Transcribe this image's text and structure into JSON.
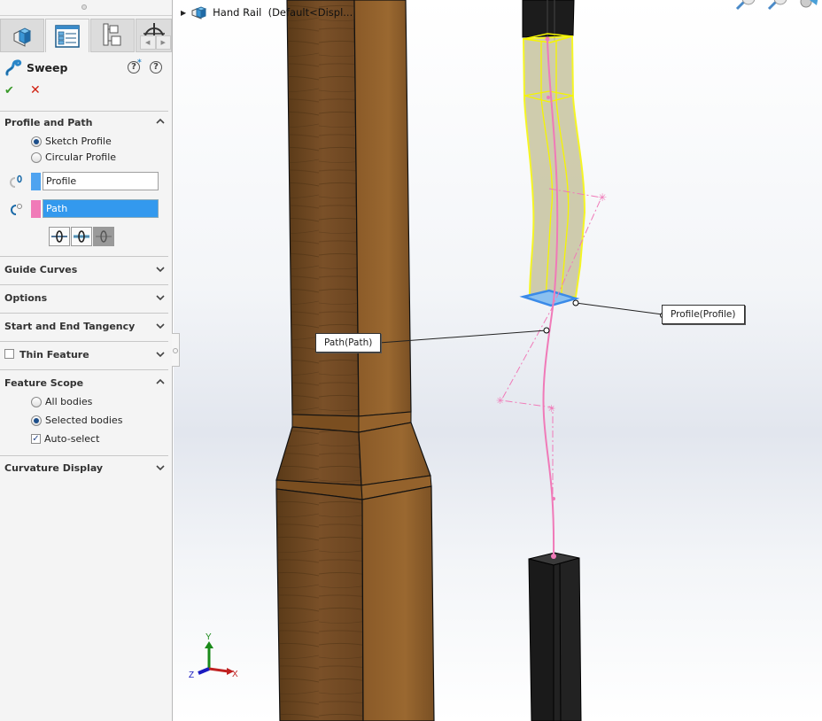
{
  "panel": {
    "tabs": [
      {
        "name": "feature-manager",
        "icon": "part-cube-icon"
      },
      {
        "name": "property-manager",
        "icon": "property-list-icon",
        "active": true
      },
      {
        "name": "configuration-manager",
        "icon": "config-tree-icon"
      },
      {
        "name": "dimxpert-manager",
        "icon": "dimxpert-icon"
      }
    ],
    "feature_title": "Sweep",
    "feature_icon": "sweep-icon",
    "help_icons": [
      "whats-new-icon",
      "help-icon"
    ],
    "ok_label": "✔",
    "cancel_label": "✕",
    "sections": {
      "profile_and_path": {
        "title": "Profile and Path",
        "expanded": true,
        "options": [
          {
            "label": "Sketch Profile",
            "selected": true
          },
          {
            "label": "Circular Profile",
            "selected": false
          }
        ],
        "profile_field": {
          "value": "Profile",
          "color": "#4fa3f0"
        },
        "path_field": {
          "value": "Path",
          "color": "#f07ab8",
          "active": true
        },
        "alignment_buttons": [
          "align-centered",
          "align-side",
          "align-default-active"
        ]
      },
      "guide_curves": {
        "title": "Guide Curves",
        "expanded": false
      },
      "options": {
        "title": "Options",
        "expanded": false
      },
      "start_end_tangency": {
        "title": "Start and End Tangency",
        "expanded": false
      },
      "thin_feature": {
        "title": "Thin Feature",
        "checked": false,
        "expanded": false
      },
      "feature_scope": {
        "title": "Feature Scope",
        "expanded": true,
        "options": [
          {
            "label": "All bodies",
            "selected": false
          },
          {
            "label": "Selected bodies",
            "selected": true
          }
        ],
        "auto_select": {
          "label": "Auto-select",
          "checked": true
        }
      },
      "curvature_display": {
        "title": "Curvature Display",
        "expanded": false
      }
    }
  },
  "viewport": {
    "tree_item": "Hand Rail  (Default<Displ...",
    "callouts": {
      "profile": "Profile(Profile)",
      "path": "Path(Path)"
    },
    "triad": {
      "x": "X",
      "y": "Y",
      "z": "Z"
    },
    "colors": {
      "profile": "#4fa3f0",
      "path": "#f07ab8",
      "preview_edge": "#f5f500",
      "wood": "#7a4f22"
    }
  }
}
